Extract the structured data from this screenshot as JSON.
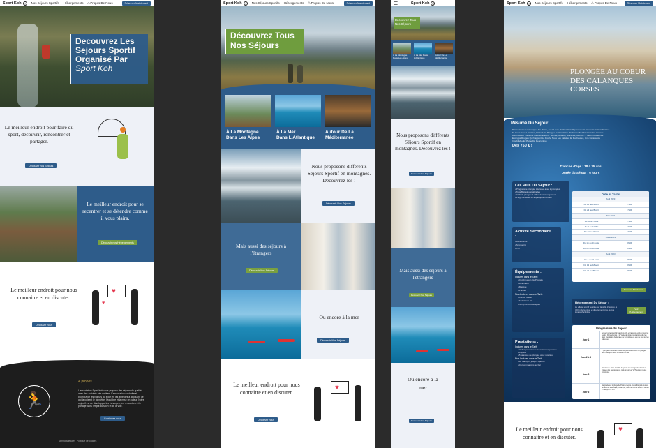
{
  "nav": {
    "brand": "Sport Koh",
    "items": [
      "Nos Séjours Sportifs",
      "Hébergements",
      "À Propos De Nous"
    ],
    "cta": "Réserver Maintenant",
    "item_a_propos_alt": "A Propos De Nous"
  },
  "panel1": {
    "hero_title_1": "Decouvrez Les",
    "hero_title_2": "Sejours Sportif",
    "hero_title_3": "Organisé Par",
    "hero_title_4": "Sport Koh",
    "section1_text": "Le meilleur endroit pour faire du sport, découvrir, rencontrer et partager.",
    "section1_btn": "Découvrir nos Séjours",
    "section2_text": "Le meilleur endroit pour se recentrer et se détendre comme il vous plaira.",
    "section2_btn": "Découvrir nos Hébergements",
    "section3_text": "Le meilleur endroit pour nous connaitre et en discuter.",
    "section3_btn": "Découvrir nous",
    "footer_heading": "A propos",
    "footer_text": "L'association Sport Koh vous propose des séjours de qualité avec des activités très variées. L'association souhaiterait promouvoir les valeurs du sport en les amenant à découvrir ce qui favorisent le bien-être, l'équilibre et la mise en valeur. Notre objectif est de développer les échanges, les rencontres et le partage dans l'esprit du sport et de la ville.",
    "footer_btn": "Contactez-nous",
    "footer_links": [
      "Mentions légales",
      "Politique de cookies"
    ]
  },
  "panel2": {
    "hero_title_1": "Découvrez Tous",
    "hero_title_2": "Nos Séjours",
    "cards": [
      {
        "line1": "À La Montagne",
        "line2": "Dans Les Alpes"
      },
      {
        "line1": "À La Mer",
        "line2": "Dans L'Atlantique"
      },
      {
        "line1": "Autour De La",
        "line2": "Méditerranée"
      }
    ],
    "mountain_text": "Nous proposons différents Séjours Sportif en montagnes. Découvrez les !",
    "mountain_btn": "Découvrir Nos Séjours",
    "abroad_text": "Mais aussi des séjours à l'étrangers",
    "abroad_btn": "Découvrir Nos Séjours",
    "sea_text": "Ou encore à la mer",
    "sea_btn": "Découvrir Nos Séjours",
    "contact_text": "Le meilleur endroit pour nous connaitre et en discuter.",
    "contact_btn": "Découvrir nous"
  },
  "panel3": {
    "brand": "Sport Koh",
    "hero_title_1": "Découvrez Tous",
    "hero_title_2": "Nos Séjours",
    "cards": [
      "À La Montagne Dans Les Alpes",
      "À La Mer Dans L'Atlantique",
      "Autour De La Méditerranée"
    ],
    "mountain_text": "Nous proposons différents Séjours Sportif en montagnes. Découvrez les !",
    "mountain_btn": "Découvrir Nos Séjours",
    "abroad_text": "Mais aussi des séjours à l'étrangers",
    "abroad_btn": "Découvrir Nos Séjours",
    "sea_text": "Ou encore à la mer",
    "sea_btn": "Découvrir Nos Séjours"
  },
  "panel4": {
    "hero_title_1": "PLONGÉE AU COEUR",
    "hero_title_2": "DES CALANQUES",
    "hero_title_3": "CORSES",
    "summary_heading": "Résumé Du Séjour",
    "summary_text": "Découvrez Les Calanques De Piana, Avec Leurs Roches Granitiques, Leurs Couleurs Extraordinaires Et Leurs Eaux Limpides, Partout En Plongée Au Fond Des Profondes Et Observez Une Grande Diversité De Poissons Méditerranéens : Sarres, Girelles, Murènes, Mérous.... Sans Oublier Les Eponges Rouges Qui Nappent La Roche Sous Les Falaises Et Rocheuses, Une Expérience Inoubliable Et Pleine De Rencontres",
    "price": "Dès 750 € !",
    "age_range": "Tranche d'âge : 18 à 35 ans",
    "duration": "Durée du Séjour : 6 jours",
    "plus_heading": "Les Plus Du Séjour :",
    "plus_items": [
      "Programme plongée intensive avec 2 plongées",
      "Tous Brigades et alizades",
      "Club de plongée à 200m de l'hébergement",
      "Plage de sable fin à quelques minutes"
    ],
    "activities_heading": "Activité Secondaire :",
    "activities_items": [
      "Randonnée",
      "Snorkeling",
      "VTT"
    ],
    "equipment_heading": "Équipements :",
    "equipment_included": "Inclures dans le Tarif :",
    "equipment_included_items": [
      "Combinaison De Plongée",
      "Détendeur",
      "Masque",
      "Palmes"
    ],
    "equipment_excluded": "Non-Inclures dans le Tarif :",
    "equipment_excluded_items": [
      "Crème Solaire",
      "T-shirt Anti-UV",
      "Syrup Anti-Moustiques"
    ],
    "services_heading": "Prestations :",
    "services_included": "Inclures dans le Tarif",
    "services_included_items": [
      "Hébergement et restauration en pension complète",
      "5 séances de plongée avec moniteur"
    ],
    "services_excluded": "Non-Inclures dans le Tarif",
    "services_excluded_items": [
      "Le transport jusqu'à Ajaccio",
      "Consommations au bar"
    ],
    "dates_heading": "Date et Tarifs",
    "dates": [
      {
        "type": "month",
        "label": "Avril 2023"
      },
      {
        "type": "row",
        "range": "Du 16 au 21 avril",
        "price": "750€"
      },
      {
        "type": "row",
        "range": "Du 23 au 28 avril",
        "price": "750€"
      },
      {
        "type": "month",
        "label": "Mai 2023"
      },
      {
        "type": "row",
        "range": "Du 30 au 5 Mai",
        "price": "750€"
      },
      {
        "type": "row",
        "range": "Du 7 au 12 Mai",
        "price": "750€"
      },
      {
        "type": "row",
        "range": "Du 14 au 19 Mai",
        "price": "750€"
      },
      {
        "type": "month",
        "label": "Juillet 2023"
      },
      {
        "type": "row",
        "range": "Du 16 au 21 juillet",
        "price": "850€"
      },
      {
        "type": "row",
        "range": "Du 23 au 28 juillet",
        "price": "850€"
      },
      {
        "type": "month",
        "label": "Août 2023"
      },
      {
        "type": "row",
        "range": "Du 6 au 11 août",
        "price": "850€"
      },
      {
        "type": "row",
        "range": "Du 13 au 18 août",
        "price": "850€"
      },
      {
        "type": "row",
        "range": "Du 20 au 25 août",
        "price": "850€"
      }
    ],
    "reserve_btn": "Réserver Maintenant",
    "housing_heading": "Hébergement Du Séjour :",
    "housing_text": "Le village sportif se situe sur la grille d'Ajaccio, à 300 m de la plage et directement près de nos locaux d'activités.",
    "housing_btn": "Voir l'Hébergement",
    "program_heading": "Programme du Séjour",
    "program": [
      {
        "day": "Jour 1",
        "text": "Accueil à l'aéroport d'Ajaccio à 10h et transport en bus jusqu'au centre. Rendez-vous à la \"tente de visite\" pour apprendre les deux spécialités de la base de la plongée en eau de mer sur les calanques"
      },
      {
        "day": "Jour 2 à 4",
        "text": "2 plongées quotidiennes sur les plus beaux sites de plongée des calanques avec la bateau du club"
      },
      {
        "day": "Jour 5",
        "text": "Randonnée dans le Golfe d'Ajaccio avec baignade dans les criques des Sanguinaires, puis un tour en VTT sur les routes forestières"
      },
      {
        "day": "Jour 6",
        "text": "Baignade sur la plage de Porto et repos disponible puis journée de détente à la plage, Pétanque, visite de la ville avant le départ à l'aéroport à 18h"
      }
    ],
    "contact_text": "Le meilleur endroit pour nous connaitre et en discuter."
  }
}
